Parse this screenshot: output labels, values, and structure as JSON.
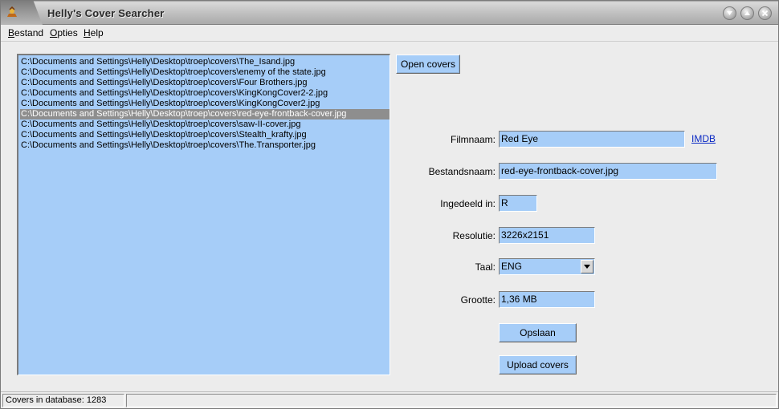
{
  "window": {
    "title": "Helly's Cover Searcher",
    "controls": [
      "minimize-icon",
      "maximize-icon",
      "close-icon"
    ]
  },
  "menu": [
    {
      "label": "Bestand"
    },
    {
      "label": "Opties"
    },
    {
      "label": "Help"
    }
  ],
  "file_list": {
    "selected_index": 5,
    "items": [
      "C:\\Documents and Settings\\Helly\\Desktop\\troep\\covers\\The_Isand.jpg",
      "C:\\Documents and Settings\\Helly\\Desktop\\troep\\covers\\enemy of the state.jpg",
      "C:\\Documents and Settings\\Helly\\Desktop\\troep\\covers\\Four Brothers.jpg",
      "C:\\Documents and Settings\\Helly\\Desktop\\troep\\covers\\KingKongCover2-2.jpg",
      "C:\\Documents and Settings\\Helly\\Desktop\\troep\\covers\\KingKongCover2.jpg",
      "C:\\Documents and Settings\\Helly\\Desktop\\troep\\covers\\red-eye-frontback-cover.jpg",
      "C:\\Documents and Settings\\Helly\\Desktop\\troep\\covers\\saw-II-cover.jpg",
      "C:\\Documents and Settings\\Helly\\Desktop\\troep\\covers\\Stealth_krafty.jpg",
      "C:\\Documents and Settings\\Helly\\Desktop\\troep\\covers\\The.Transporter.jpg"
    ]
  },
  "buttons": {
    "open_covers": "Open covers",
    "save": "Opslaan",
    "upload": "Upload covers"
  },
  "form": {
    "filmnaam": {
      "label": "Filmnaam:",
      "value": "Red Eye",
      "link": "IMDB"
    },
    "bestandsnaam": {
      "label": "Bestandsnaam:",
      "value": "red-eye-frontback-cover.jpg"
    },
    "ingedeeld": {
      "label": "Ingedeeld in:",
      "value": "R"
    },
    "resolutie": {
      "label": "Resolutie:",
      "value": "3226x2151"
    },
    "taal": {
      "label": "Taal:",
      "value": "ENG"
    },
    "grootte": {
      "label": "Grootte:",
      "value": "1,36 MB"
    }
  },
  "status": {
    "covers": "Covers in database: 1283"
  },
  "colors": {
    "field_bg": "#a6cdf8",
    "selection": "#8e8e8e",
    "link": "#0a29c4"
  }
}
